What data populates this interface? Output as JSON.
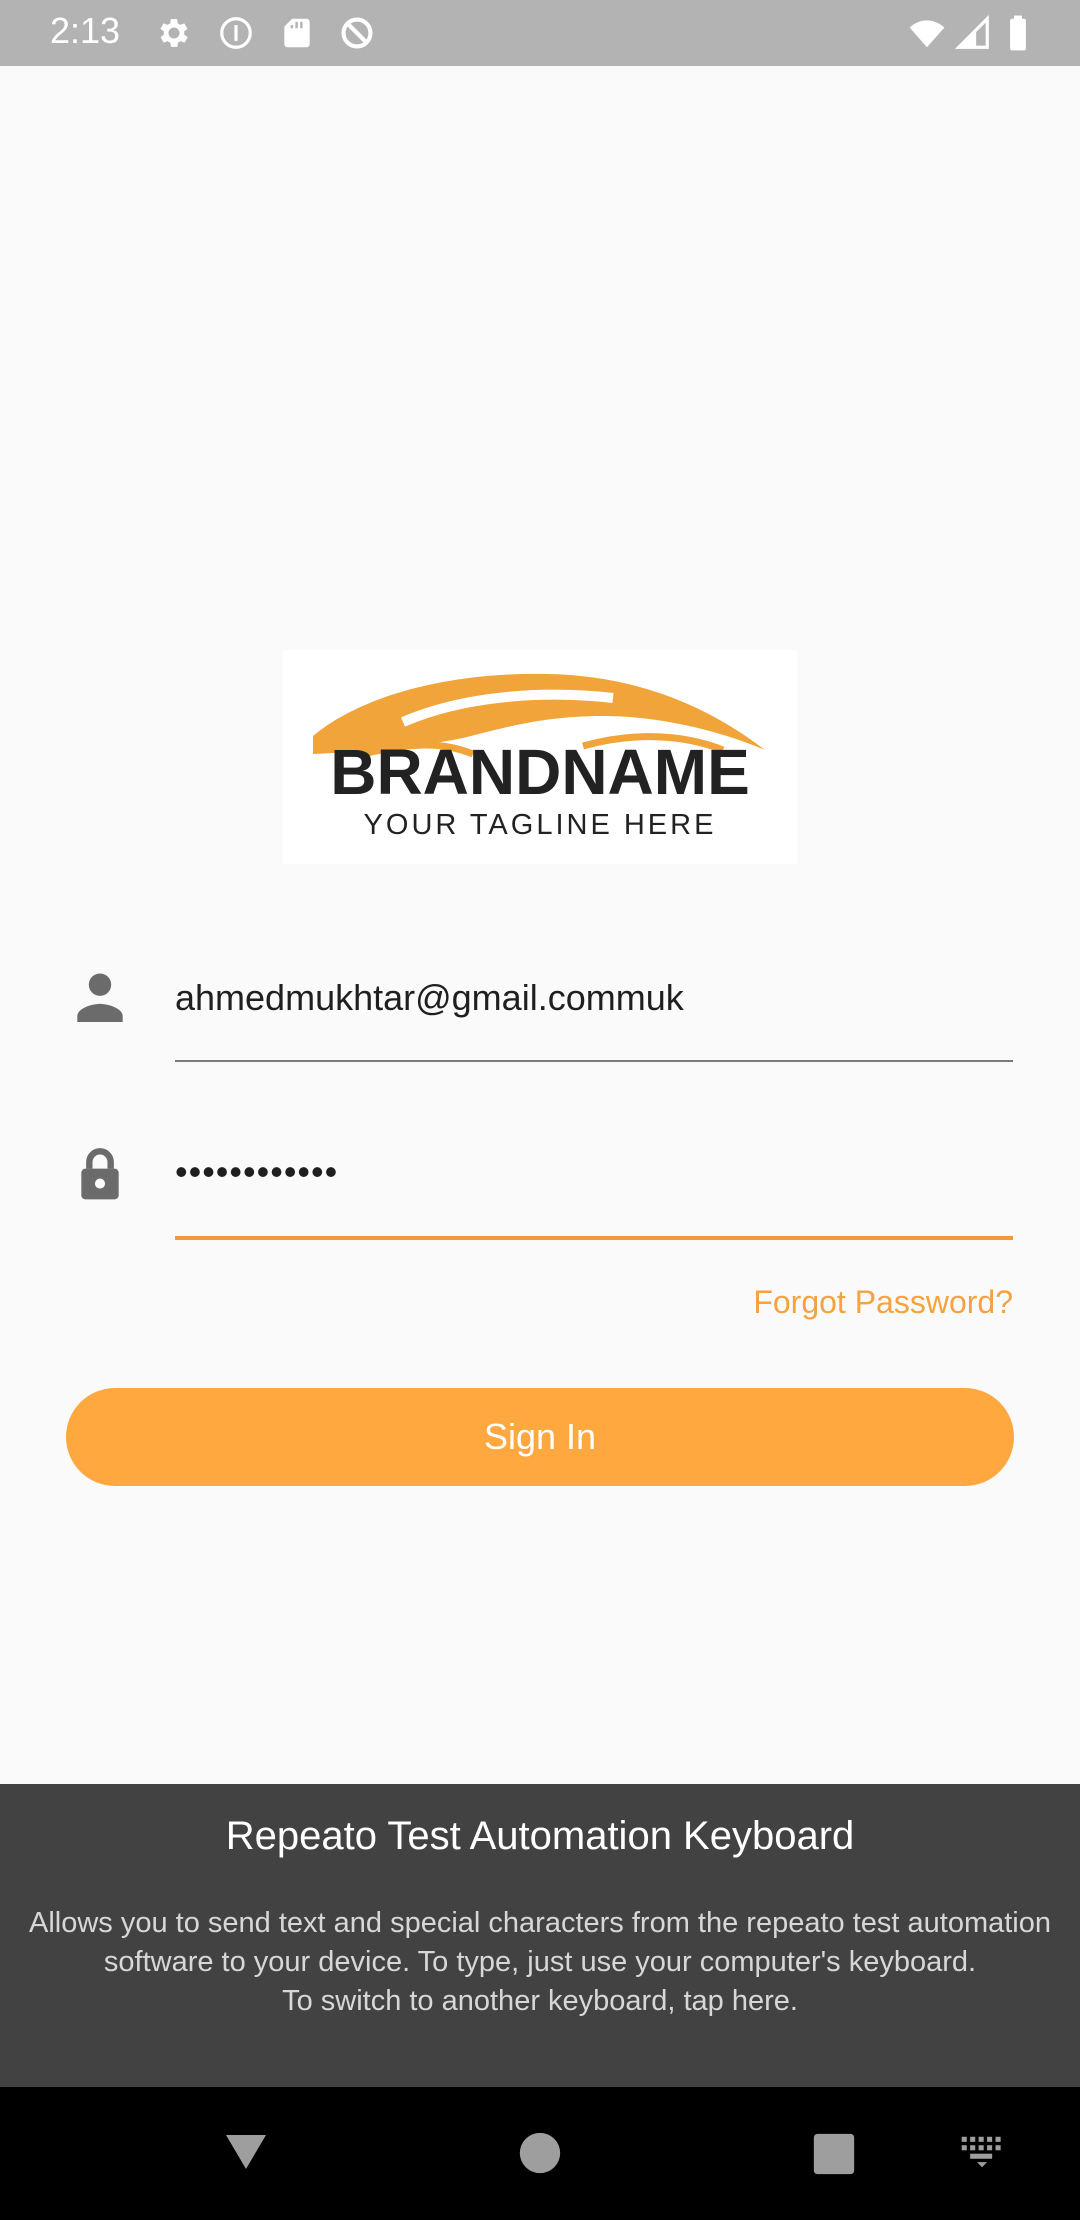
{
  "status_bar": {
    "time": "2:13",
    "icons": [
      "gear-icon",
      "info-icon",
      "sd-card-icon",
      "sync-off-icon",
      "wifi-icon",
      "signal-icon",
      "battery-icon"
    ]
  },
  "login_form": {
    "email_value": "ahmedmukhtar@gmail.commuk",
    "password_value": "••••••••••••",
    "forgot_label": "Forgot Password?",
    "signin_label": "Sign In"
  },
  "keyboard_panel": {
    "title": "Repeato Test Automation Keyboard",
    "desc_line1": "Allows you to send text and special characters from the repeato test automation software to your device. To type, just use your computer's keyboard.",
    "desc_line2": "To switch to another keyboard, tap here."
  },
  "logo": {
    "brand_text": "BRANDNAME",
    "tagline_text": "YOUR TAGLINE HERE"
  },
  "colors": {
    "accent": "#fea83f",
    "link": "#f5a340",
    "panel_bg": "#424242",
    "status_bg": "#b3b3b3"
  },
  "nav_bar": {
    "icons": [
      "back-icon",
      "home-icon",
      "recents-icon",
      "keyboard-icon"
    ]
  }
}
